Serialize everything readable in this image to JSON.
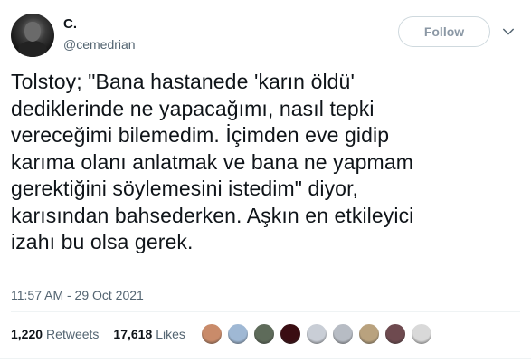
{
  "author": {
    "display_name": "C.",
    "handle": "@cemedrian"
  },
  "follow_button": {
    "label": "Follow"
  },
  "tweet": {
    "text": "Tolstoy; \"Bana hastanede 'karın öldü'\ndediklerinde ne yapacağımı, nasıl tepki\nvereceğimi bilemedim. İçimden eve gidip\nkarıma olanı anlatmak ve bana ne yapmam\ngerektiğini söylemesini istedim\" diyor,\nkarısından bahsederken. Aşkın en etkileyici\nizahı bu olsa gerek.",
    "timestamp": "11:57 AM - 29 Oct 2021"
  },
  "stats": {
    "retweets_count": "1,220",
    "retweets_label": "Retweets",
    "likes_count": "17,618",
    "likes_label": "Likes"
  },
  "likers": [
    {
      "color": "#c98b6a"
    },
    {
      "color": "#9fb8d4"
    },
    {
      "color": "#5e6b5a"
    },
    {
      "color": "#3a0d12"
    },
    {
      "color": "#c9ced6"
    },
    {
      "color": "#b7bcc4"
    },
    {
      "color": "#b9a27e"
    },
    {
      "color": "#6e4a4f"
    },
    {
      "color": "#d9d9d9"
    }
  ]
}
